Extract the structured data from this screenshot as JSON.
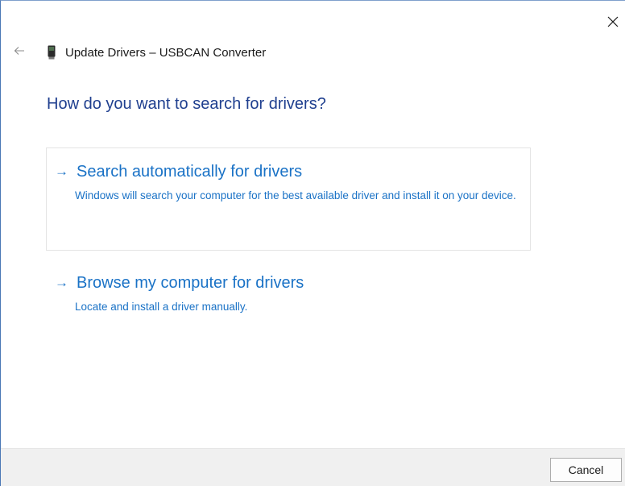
{
  "window": {
    "title": "Update Drivers – USBCAN Converter",
    "close_icon": "close-icon",
    "back_icon": "back-arrow-icon",
    "device_icon": "usb-device-icon"
  },
  "main": {
    "heading": "How do you want to search for drivers?",
    "options": [
      {
        "arrow": "→",
        "title": "Search automatically for drivers",
        "description": "Windows will search your computer for the best available driver and install it on your device."
      },
      {
        "arrow": "→",
        "title": "Browse my computer for drivers",
        "description": "Locate and install a driver manually."
      }
    ]
  },
  "footer": {
    "cancel_label": "Cancel"
  },
  "colors": {
    "heading": "#1f3f8f",
    "link": "#1a72c6",
    "footer_bg": "#f0f0f0"
  }
}
